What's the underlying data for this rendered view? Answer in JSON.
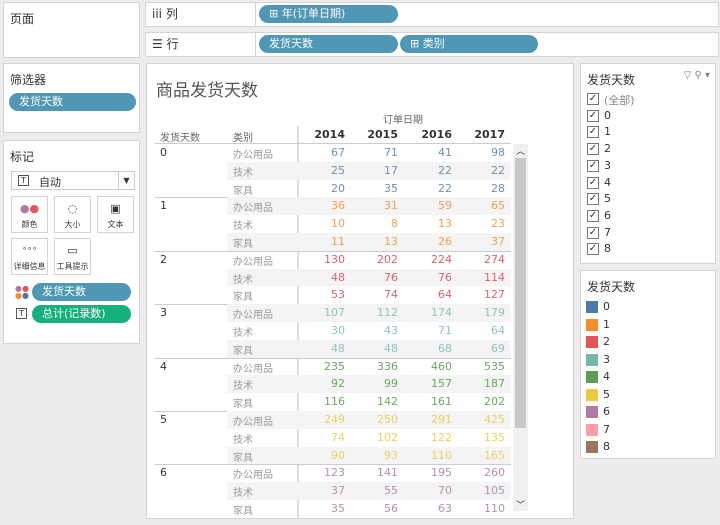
{
  "pages": {
    "title": "页面"
  },
  "filters": {
    "title": "筛选器",
    "pill": "发货天数"
  },
  "marks": {
    "title": "标记",
    "type": "自动",
    "buttons": [
      "颜色",
      "大小",
      "文本",
      "详细信息",
      "工具提示"
    ],
    "color_pill": "发货天数",
    "text_pill": "总计(记录数)"
  },
  "shelves": {
    "columns_label": "列",
    "columns": [
      "⊞ 年(订单日期)"
    ],
    "rows_label": "行",
    "rows": [
      "发货天数",
      "⊞ 类别"
    ]
  },
  "view": {
    "title": "商品发货天数",
    "col_header": "订单日期",
    "row_headers": [
      "发货天数",
      "类别"
    ],
    "years": [
      "2014",
      "2015",
      "2016",
      "2017"
    ],
    "groups": [
      {
        "key": "0",
        "rows": [
          [
            "办公用品",
            67,
            71,
            41,
            98
          ],
          [
            "技术",
            25,
            17,
            22,
            22
          ],
          [
            "家具",
            20,
            35,
            22,
            28
          ]
        ]
      },
      {
        "key": "1",
        "rows": [
          [
            "办公用品",
            36,
            31,
            59,
            65
          ],
          [
            "技术",
            10,
            8,
            13,
            23
          ],
          [
            "家具",
            11,
            13,
            26,
            37
          ]
        ]
      },
      {
        "key": "2",
        "rows": [
          [
            "办公用品",
            130,
            202,
            224,
            274
          ],
          [
            "技术",
            48,
            76,
            76,
            114
          ],
          [
            "家具",
            53,
            74,
            64,
            127
          ]
        ]
      },
      {
        "key": "3",
        "rows": [
          [
            "办公用品",
            107,
            112,
            174,
            179
          ],
          [
            "技术",
            30,
            43,
            71,
            64
          ],
          [
            "家具",
            48,
            48,
            68,
            69
          ]
        ]
      },
      {
        "key": "4",
        "rows": [
          [
            "办公用品",
            235,
            336,
            460,
            535
          ],
          [
            "技术",
            92,
            99,
            157,
            187
          ],
          [
            "家具",
            116,
            142,
            161,
            202
          ]
        ]
      },
      {
        "key": "5",
        "rows": [
          [
            "办公用品",
            249,
            250,
            291,
            425
          ],
          [
            "技术",
            74,
            102,
            122,
            135
          ],
          [
            "家具",
            90,
            93,
            110,
            165
          ]
        ]
      },
      {
        "key": "6",
        "rows": [
          [
            "办公用品",
            123,
            141,
            195,
            260
          ],
          [
            "技术",
            37,
            55,
            70,
            105
          ],
          [
            "家具",
            35,
            56,
            63,
            110
          ]
        ]
      }
    ]
  },
  "text_colors": [
    "#6f8fb5",
    "#f0a050",
    "#d9626b",
    "#8cc4bf",
    "#6aa85e",
    "#ecd060",
    "#b78fb0",
    "#f5a0a8",
    "#a68470"
  ],
  "filter_card": {
    "title": "发货天数",
    "items": [
      "(全部)",
      "0",
      "1",
      "2",
      "3",
      "4",
      "5",
      "6",
      "7",
      "8"
    ]
  },
  "legend": {
    "title": "发货天数",
    "items": [
      "0",
      "1",
      "2",
      "3",
      "4",
      "5",
      "6",
      "7",
      "8"
    ],
    "colors": [
      "#4e79a7",
      "#f28e2b",
      "#e15759",
      "#76b7b2",
      "#59a14f",
      "#edc948",
      "#b07aa1",
      "#ff9da7",
      "#9c755f"
    ]
  }
}
